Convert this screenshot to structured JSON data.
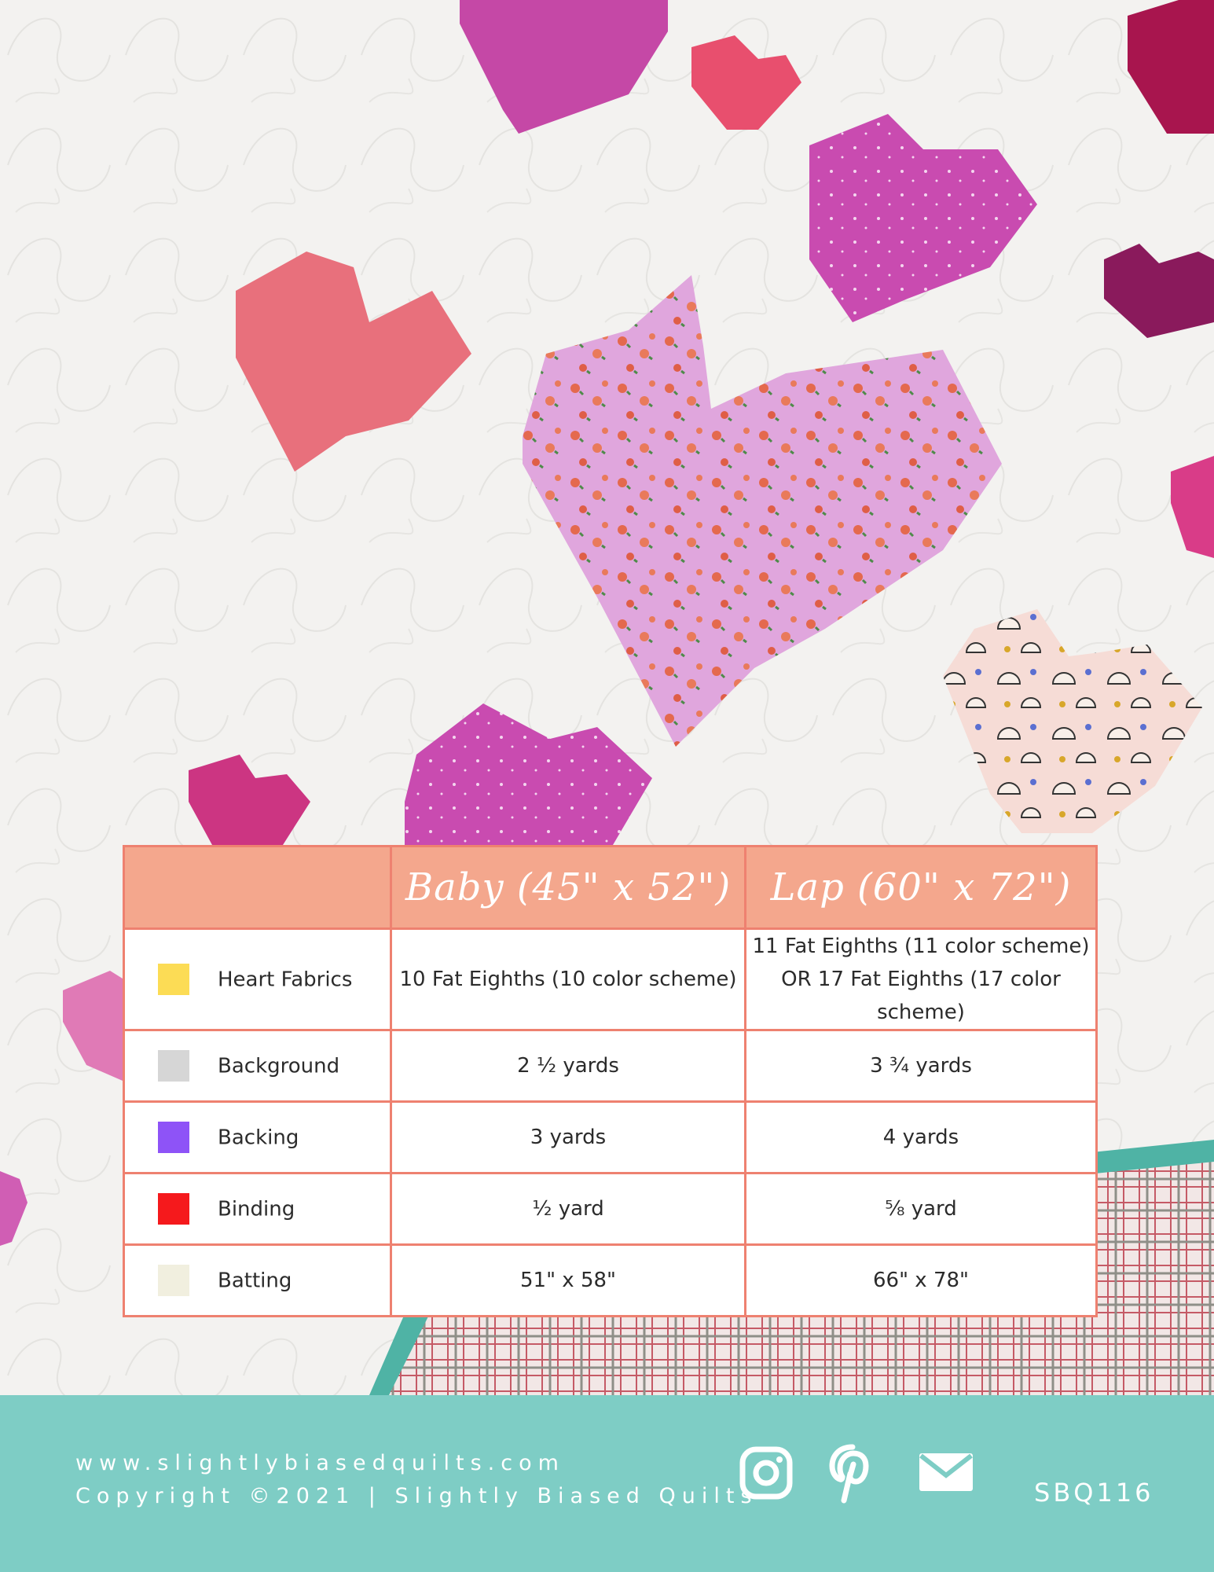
{
  "colors": {
    "table_header": "#f4a78d",
    "table_border": "#ee8170",
    "footer_bar": "#7ecdc5",
    "quilt_background": "#f3f2f0"
  },
  "table": {
    "header": {
      "blank": "",
      "baby": "Baby (45\" x 52\")",
      "lap": "Lap (60\" x 72\")"
    },
    "rows": [
      {
        "fabric": "Heart Fabrics",
        "swatch_color": "#fcdc55",
        "baby": "10 Fat Eighths (10 color scheme)",
        "lap": "11 Fat Eighths (11 color scheme) OR 17 Fat Eighths (17 color scheme)"
      },
      {
        "fabric": "Background",
        "swatch_color": "#d6d6d6",
        "baby": "2 ½ yards",
        "lap": "3 ¾ yards"
      },
      {
        "fabric": "Backing",
        "swatch_color": "#8e53f7",
        "baby": "3 yards",
        "lap": "4 yards"
      },
      {
        "fabric": "Binding",
        "swatch_color": "#f5191c",
        "baby": "½ yard",
        "lap": "⅝ yard"
      },
      {
        "fabric": "Batting",
        "swatch_color": "#f1efdf",
        "baby": "51\" x 58\"",
        "lap": "66\" x 78\""
      }
    ]
  },
  "footer": {
    "website": "www.slightlybiasedquilts.com",
    "copyright": "Copyright ©2021 | Slightly Biased Quilts",
    "sku": "SBQ116",
    "icons": [
      "instagram-icon",
      "pinterest-icon",
      "email-icon"
    ]
  }
}
